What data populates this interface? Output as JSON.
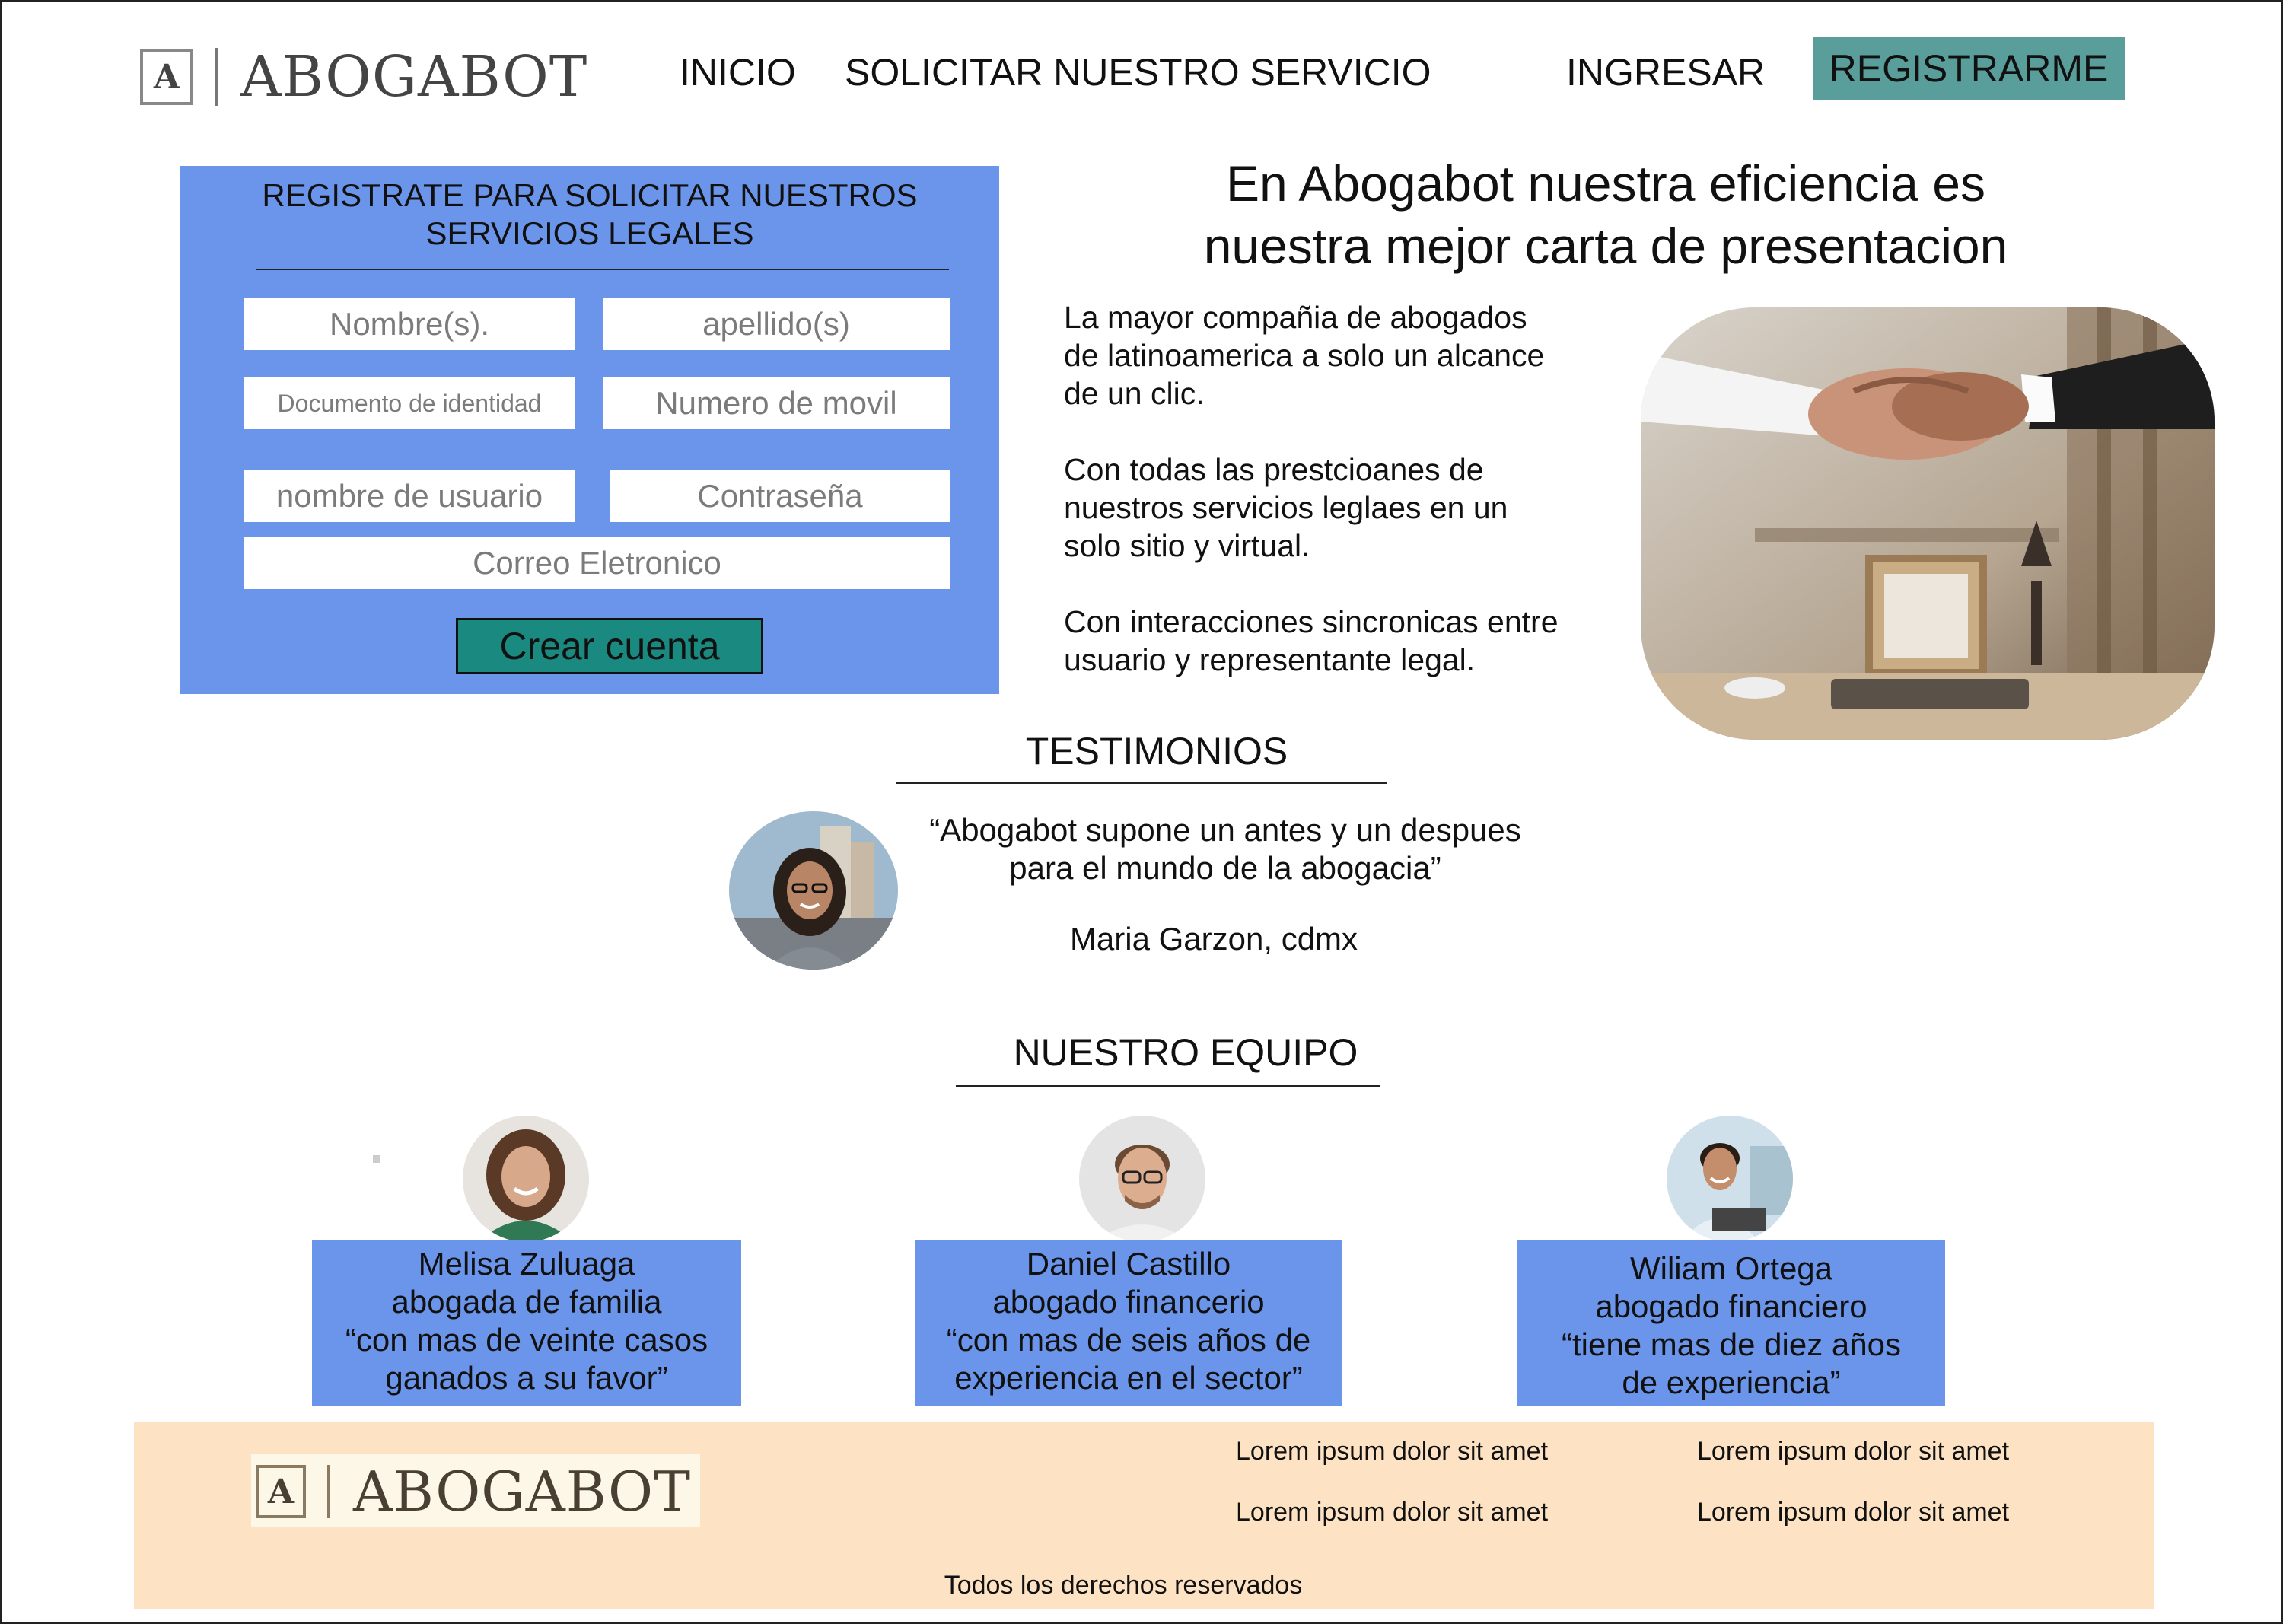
{
  "brand": {
    "name": "ABOGABOT",
    "mark": "A"
  },
  "nav": {
    "inicio": "INICIO",
    "solicitar": "SOLICITAR NUESTRO SERVICIO",
    "ingresar": "INGRESAR",
    "registrarme": "REGISTRARME"
  },
  "form": {
    "title_line1": "REGISTRATE PARA SOLICITAR NUESTROS",
    "title_line2": "SERVICIOS LEGALES",
    "nombre_placeholder": "Nombre(s).",
    "apellido_placeholder": "apellido(s)",
    "documento_placeholder": "Documento de identidad",
    "movil_placeholder": "Numero de movil",
    "usuario_placeholder": "nombre de usuario",
    "contrasena_placeholder": "Contraseña",
    "correo_placeholder": "Correo Eletronico",
    "submit_label": "Crear cuenta"
  },
  "hero": {
    "title_line1": "En Abogabot nuestra eficiencia es",
    "title_line2": "nuestra mejor carta de presentacion",
    "p1_line1": "La mayor compañia de abogados",
    "p1_line2": "de latinoamerica a solo un alcance",
    "p1_line3": "de un clic.",
    "p2_line1": "Con todas las prestcioanes de",
    "p2_line2": "nuestros servicios leglaes en un",
    "p2_line3": "solo sitio y virtual.",
    "p3_line1": "Con interacciones sincronicas entre",
    "p3_line2": "usuario y representante legal."
  },
  "testimonios": {
    "title": "TESTIMONIOS",
    "quote_line1": "“Abogabot supone un antes y un despues",
    "quote_line2": "para el mundo de la abogacia”",
    "author": "Maria Garzon, cdmx"
  },
  "equipo": {
    "title": "NUESTRO EQUIPO",
    "members": [
      {
        "name": "Melisa Zuluaga",
        "role": "abogada de familia",
        "quote_line1": "“con mas de veinte casos",
        "quote_line2": "ganados a su favor”"
      },
      {
        "name": "Daniel Castillo",
        "role": "abogado financerio",
        "quote_line1": "“con mas de seis años de",
        "quote_line2": "experiencia en el sector”"
      },
      {
        "name": "Wiliam Ortega",
        "role": "abogado financiero",
        "quote_line1": "“tiene mas de diez años",
        "quote_line2": "de experiencia”"
      }
    ]
  },
  "footer": {
    "links": [
      "Lorem ipsum dolor sit amet",
      "Lorem ipsum dolor sit amet",
      "Lorem ipsum dolor sit amet",
      "Lorem ipsum dolor sit amet"
    ],
    "copyright": "Todos los derechos reservados"
  },
  "colors": {
    "accent_blue": "#6b95ea",
    "teal": "#5a9e9c",
    "button_teal": "#1a8a80",
    "footer_bg": "#fde3c4"
  }
}
